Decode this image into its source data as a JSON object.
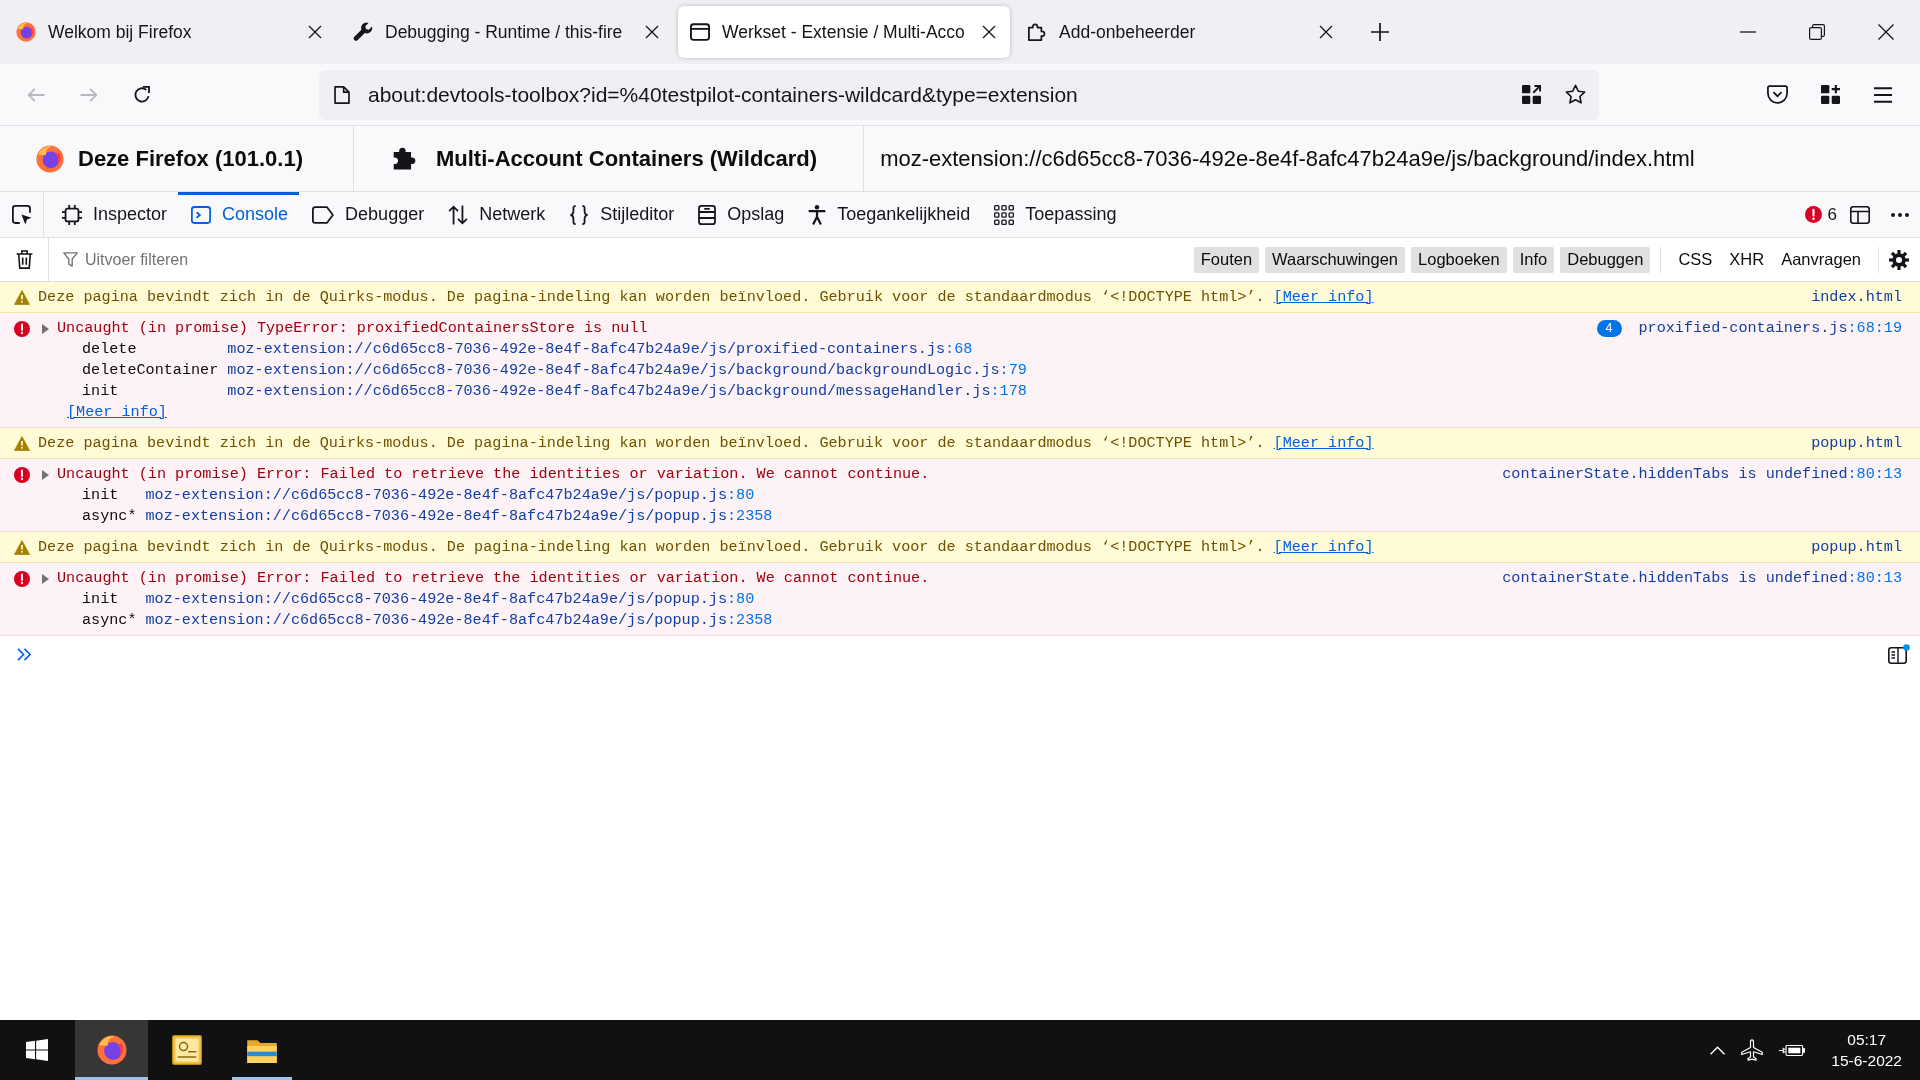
{
  "browser": {
    "tabs": [
      {
        "title": "Welkom bij Firefox",
        "selected": false
      },
      {
        "title": "Debugging - Runtime / this-fire",
        "selected": false
      },
      {
        "title": "Werkset - Extensie / Multi-Acco",
        "selected": true
      },
      {
        "title": "Add-onbeheerder",
        "selected": false
      }
    ],
    "nav_buttons": [
      {
        "disabled": true
      },
      {
        "disabled": true
      },
      {
        "disabled": false
      }
    ],
    "address": "about:devtools-toolbox?id=%40testpilot-containers-wildcard&type=extension"
  },
  "devtools": {
    "header": {
      "runtime": "Deze Firefox (101.0.1)",
      "extension": "Multi-Account Containers (Wildcard)",
      "url": "moz-extension://c6d65cc8-7036-492e-8e4f-8afc47b24a9e/js/background/index.html"
    },
    "tools": [
      {
        "label": "Inspector",
        "selected": false
      },
      {
        "label": "Console",
        "selected": true
      },
      {
        "label": "Debugger",
        "selected": false
      },
      {
        "label": "Netwerk",
        "selected": false
      },
      {
        "label": "Stijleditor",
        "selected": false
      },
      {
        "label": "Opslag",
        "selected": false
      },
      {
        "label": "Toegankelijkheid",
        "selected": false
      },
      {
        "label": "Toepassing",
        "selected": false
      }
    ],
    "error_count": "6",
    "console": {
      "filter": {
        "placeholder": "Uitvoer filteren"
      },
      "level_filters": [
        {
          "label": "Fouten",
          "checked": true
        },
        {
          "label": "Waarschuwingen",
          "checked": true
        },
        {
          "label": "Logboeken",
          "checked": true
        },
        {
          "label": "Info",
          "checked": true
        },
        {
          "label": "Debuggen",
          "checked": true
        }
      ],
      "type_filters": [
        {
          "label": "CSS",
          "checked": false
        },
        {
          "label": "XHR",
          "checked": false
        },
        {
          "label": "Aanvragen",
          "checked": false
        }
      ],
      "messages": [
        {
          "kind": "warning",
          "text": "Deze pagina bevindt zich in de Quirks-modus. De pagina-indeling kan worden beïnvloed. Gebruik voor de standaardmodus ‘<!DOCTYPE html>’.",
          "link": "[Meer info]",
          "source": {
            "file": "index.html"
          }
        },
        {
          "kind": "error",
          "text": "Uncaught (in promise) TypeError: proxifiedContainersStore is null",
          "repeat": "4",
          "source": {
            "file": "proxified-containers.js",
            "position": ":68:19"
          },
          "stack": [
            {
              "function": "delete",
              "file": "moz-extension://c6d65cc8-7036-492e-8e4f-8afc47b24a9e/js/proxified-containers.js",
              "line": ":68"
            },
            {
              "function": "deleteContainer",
              "file": "moz-extension://c6d65cc8-7036-492e-8e4f-8afc47b24a9e/js/background/backgroundLogic.js",
              "line": ":79"
            },
            {
              "function": "init",
              "file": "moz-extension://c6d65cc8-7036-492e-8e4f-8afc47b24a9e/js/background/messageHandler.js",
              "line": ":178"
            }
          ],
          "link": "[Meer info]"
        },
        {
          "kind": "warning",
          "text": "Deze pagina bevindt zich in de Quirks-modus. De pagina-indeling kan worden beïnvloed. Gebruik voor de standaardmodus ‘<!DOCTYPE html>’.",
          "link": "[Meer info]",
          "source": {
            "file": "popup.html"
          }
        },
        {
          "kind": "error",
          "text": "Uncaught (in promise) Error: Failed to retrieve the identities or variation. We cannot continue.",
          "source": {
            "file": "containerState.hiddenTabs is undefined",
            "position": ":80:13"
          },
          "stack": [
            {
              "function": "init",
              "file": "moz-extension://c6d65cc8-7036-492e-8e4f-8afc47b24a9e/js/popup.js",
              "line": ":80"
            },
            {
              "function": "async*",
              "file": "moz-extension://c6d65cc8-7036-492e-8e4f-8afc47b24a9e/js/popup.js",
              "line": ":2358"
            }
          ]
        },
        {
          "kind": "warning",
          "text": "Deze pagina bevindt zich in de Quirks-modus. De pagina-indeling kan worden beïnvloed. Gebruik voor de standaardmodus ‘<!DOCTYPE html>’.",
          "link": "[Meer info]",
          "source": {
            "file": "popup.html"
          }
        },
        {
          "kind": "error",
          "text": "Uncaught (in promise) Error: Failed to retrieve the identities or variation. We cannot continue.",
          "source": {
            "file": "containerState.hiddenTabs is undefined",
            "position": ":80:13"
          },
          "stack": [
            {
              "function": "init",
              "file": "moz-extension://c6d65cc8-7036-492e-8e4f-8afc47b24a9e/js/popup.js",
              "line": ":80"
            },
            {
              "function": "async*",
              "file": "moz-extension://c6d65cc8-7036-492e-8e4f-8afc47b24a9e/js/popup.js",
              "line": ":2358"
            }
          ]
        }
      ]
    }
  },
  "taskbar": {
    "apps": [
      {
        "active": true,
        "running": true
      },
      {
        "active": false,
        "running": false
      },
      {
        "active": false,
        "running": true
      }
    ],
    "time": "05:17",
    "date": "15-6-2022"
  }
}
